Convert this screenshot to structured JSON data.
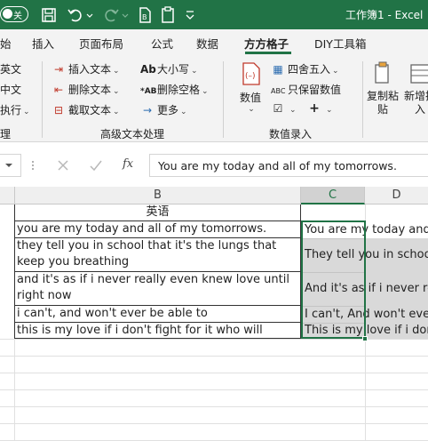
{
  "titlebar": {
    "autosave_label": "关",
    "title": "工作簿1  -  Excel"
  },
  "tabs": [
    "始",
    "插入",
    "页面布局",
    "公式",
    "数据",
    "方方格子",
    "DIY工具箱"
  ],
  "ribbon": {
    "left_cut": [
      "英文",
      "中文",
      "执行"
    ],
    "text_buttons": [
      "插入文本",
      "删除文本",
      "截取文本"
    ],
    "case_buttons": [
      "大小写",
      "删除空格",
      "更多"
    ],
    "numeric_buttons": [
      "数值",
      "四舍五入",
      "只保留数值"
    ],
    "right_buttons": [
      "复制粘贴",
      "新增插入"
    ],
    "group_labels": [
      "理",
      "高级文本处理",
      "数值录入"
    ]
  },
  "formula_bar": {
    "fx": "fx",
    "value": "You are my today and all of my tomorrows."
  },
  "columns": [
    "B",
    "C",
    "D"
  ],
  "sheet": {
    "b_header": "英语",
    "b_rows": [
      "you are my today and all of my tomorrows.",
      "they tell you in school that it's the lungs that keep you breathing",
      "and it's as if i never really even knew love until right now",
      "i can't, and won't ever be able to",
      "this is my love if i don't fight for it who will"
    ],
    "c_rows": [
      "You are my today and all of my tomorrows.",
      "They tell you in school that it's the lungs that keep you breathing",
      "And it's as if i never really even knew love until right now",
      "I can't, And won't ever be able to",
      "This is my love if i don't fight for it who will"
    ]
  },
  "colors": {
    "accent": "#217346",
    "selection": "#d9d9d9"
  }
}
